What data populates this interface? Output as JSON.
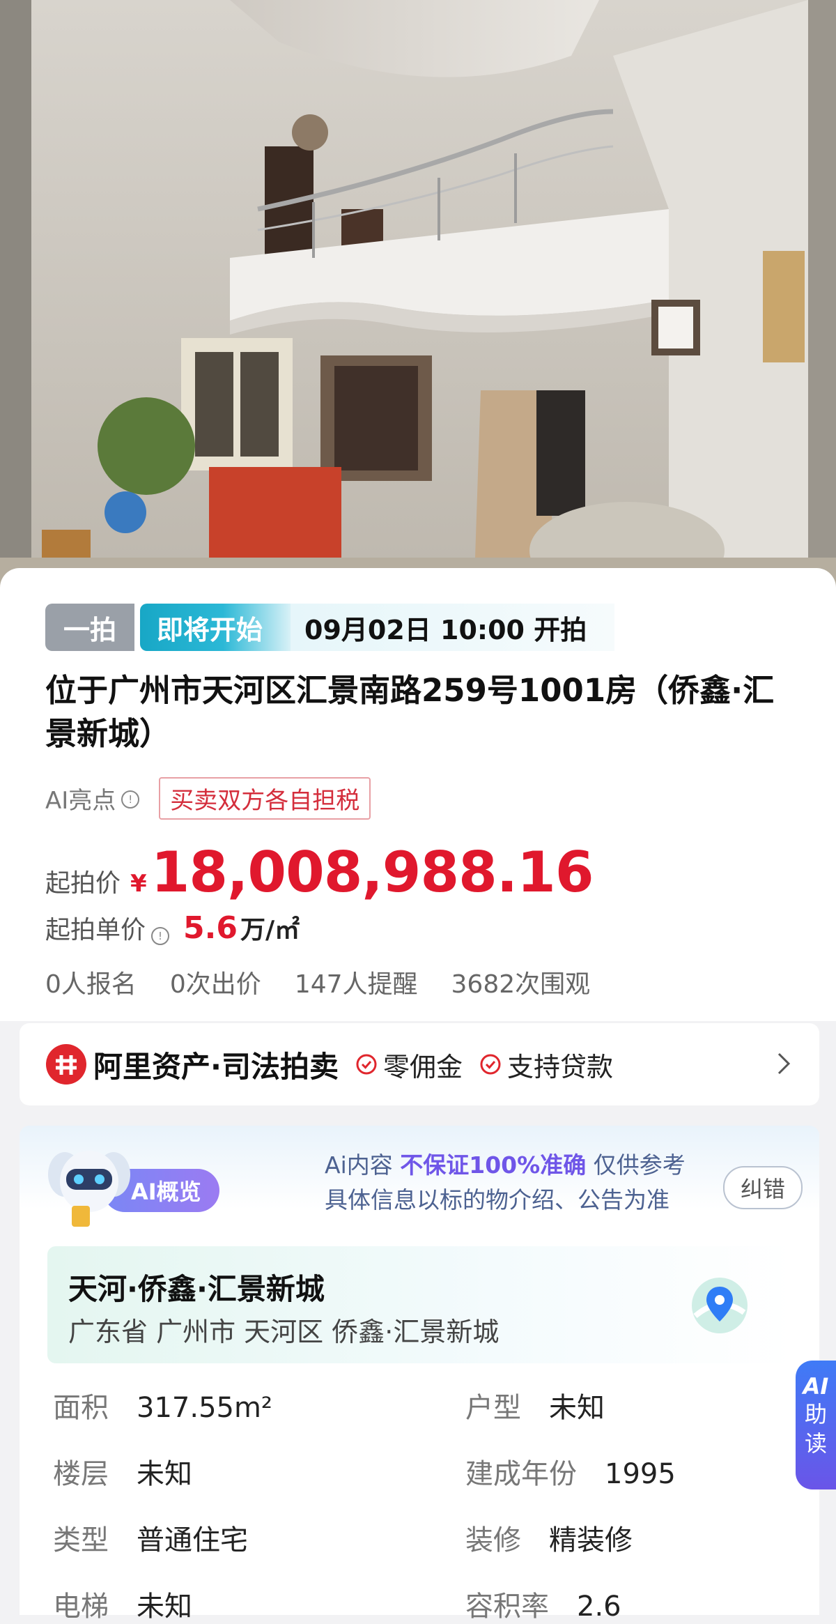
{
  "status": {
    "round_tag": "一拍",
    "status_tag": "即将开始",
    "start_time": "09月02日 10:00 开拍"
  },
  "listing": {
    "title": "位于广州市天河区汇景南路259号1001房（侨鑫·汇景新城）",
    "ai_highlight_label": "AI亮点",
    "ai_highlight_tag": "买卖双方各自担税"
  },
  "price": {
    "start_label": "起拍价",
    "currency": "¥",
    "start_value": "18,008,988.16",
    "unit_label": "起拍单价",
    "unit_value": "5.6",
    "unit_suffix": "万/㎡"
  },
  "stats": [
    "0人报名",
    "0次出价",
    "147人提醒",
    "3682次围观"
  ],
  "platform": {
    "name": "阿里资产·司法拍卖",
    "features": [
      "零佣金",
      "支持贷款"
    ]
  },
  "ai_overview": {
    "badge": "AI概览",
    "disclaimer_prefix": "Ai内容",
    "disclaimer_highlight": "不保证100%准确",
    "disclaimer_suffix": "仅供参考",
    "disclaimer_line2": "具体信息以标的物介绍、公告为准",
    "correct_button": "纠错"
  },
  "location": {
    "title": "天河·侨鑫·汇景新城",
    "address": "广东省 广州市 天河区 侨鑫·汇景新城"
  },
  "specs": [
    {
      "key": "面积",
      "value": "317.55m²"
    },
    {
      "key": "户型",
      "value": "未知"
    },
    {
      "key": "楼层",
      "value": "未知"
    },
    {
      "key": "建成年份",
      "value": "1995"
    },
    {
      "key": "类型",
      "value": "普通住宅"
    },
    {
      "key": "装修",
      "value": "精装修"
    },
    {
      "key": "电梯",
      "value": "未知"
    },
    {
      "key": "容积率",
      "value": "2.6"
    }
  ],
  "side_button": {
    "line1": "AI",
    "line2": "助",
    "line3": "读"
  },
  "colors": {
    "price_red": "#e0182d",
    "status_teal": "#18a7c6",
    "ai_purple": "#6f56e8"
  }
}
